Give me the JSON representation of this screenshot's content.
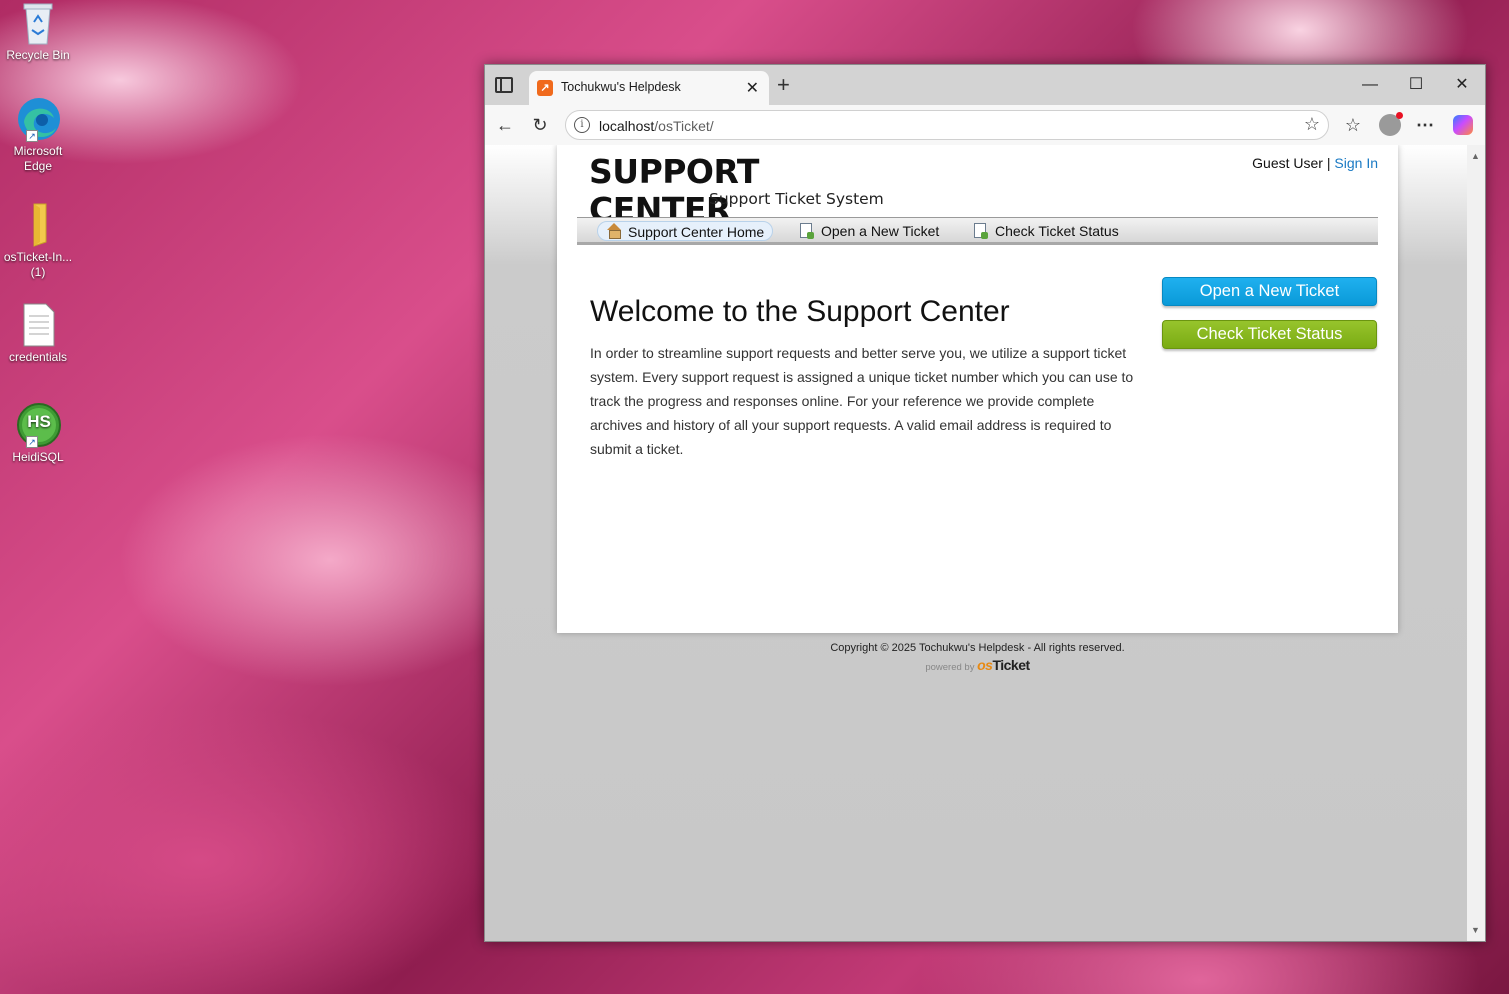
{
  "desktop": {
    "icons": [
      {
        "label": "Recycle Bin"
      },
      {
        "label": "Microsoft Edge"
      },
      {
        "label": "osTicket-In... (1)"
      },
      {
        "label": "credentials"
      },
      {
        "label": "HeidiSQL",
        "badge": "HS"
      }
    ]
  },
  "browser": {
    "tab_title": "Tochukwu's Helpdesk",
    "url_host": "localhost",
    "url_path": "/osTicket/",
    "window_controls": {
      "minimize": "—",
      "maximize": "☐",
      "close": "✕"
    },
    "colors": {
      "tab_favicon": "#f06a1d",
      "profile_dot": "#e81123"
    }
  },
  "site": {
    "logo_title": "SUPPORT CENTER",
    "logo_subtitle": "Support Ticket System",
    "guest_label": "Guest User",
    "separator": "|",
    "sign_in": "Sign In",
    "nav": [
      {
        "label": "Support Center Home",
        "icon": "home-icon",
        "active": true
      },
      {
        "label": "Open a New Ticket",
        "icon": "new-ticket-icon"
      },
      {
        "label": "Check Ticket Status",
        "icon": "ticket-status-icon"
      }
    ],
    "welcome_heading": "Welcome to the Support Center",
    "intro_text": "In order to streamline support requests and better serve you, we utilize a support ticket system. Every support request is assigned a unique ticket number which you can use to track the progress and responses online. For your reference we provide complete archives and history of all your support requests. A valid email address is required to submit a ticket.",
    "buttons": {
      "open_ticket": "Open a New Ticket",
      "check_status": "Check Ticket Status"
    },
    "colors": {
      "open_ticket": "#0fa4e4",
      "check_status": "#86b71b",
      "link": "#1a7ac4"
    },
    "footer_copyright": "Copyright © 2025 Tochukwu's Helpdesk - All rights reserved.",
    "powered_by": "powered by",
    "powered_brand_os": "os",
    "powered_brand_ticket": "Ticket"
  }
}
